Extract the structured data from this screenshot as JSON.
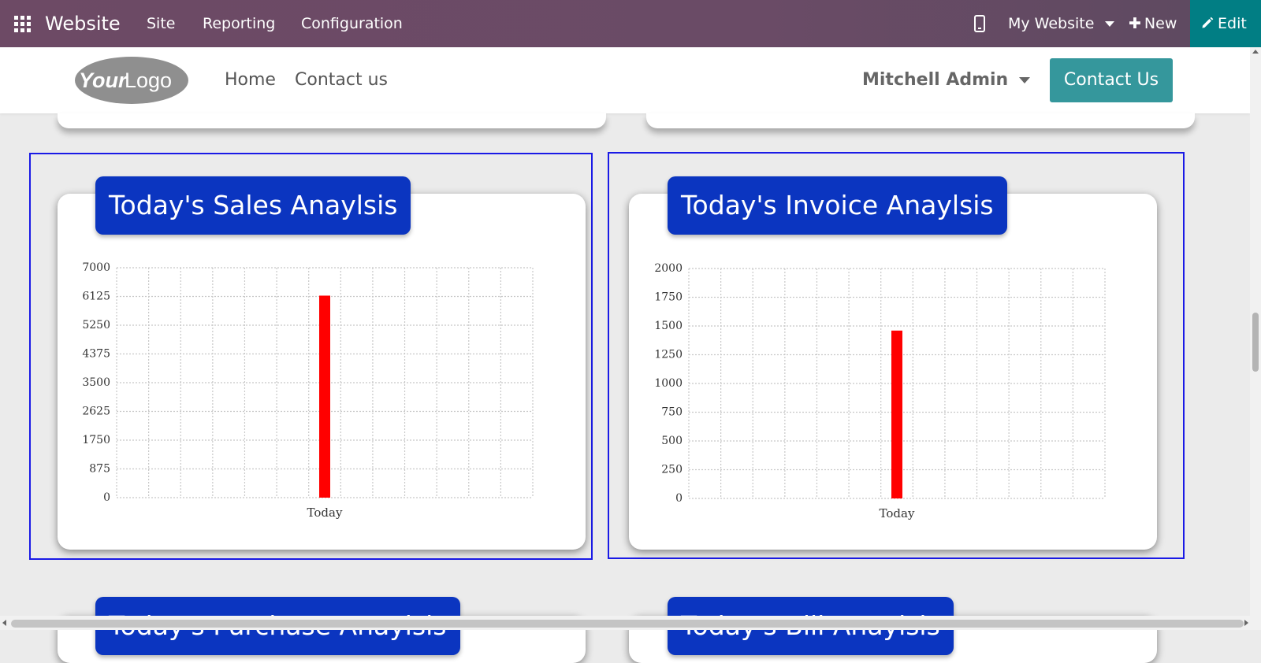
{
  "topbar": {
    "app_name": "Website",
    "menu": [
      "Site",
      "Reporting",
      "Configuration"
    ],
    "website_selector": "My Website",
    "new_label": "New",
    "edit_label": "Edit"
  },
  "header": {
    "logo_text_bold": "Your",
    "logo_text_light": "Logo",
    "nav": [
      "Home",
      "Contact us"
    ],
    "user": "Mitchell Admin",
    "contact_button": "Contact Us"
  },
  "cards": {
    "sales_title": "Today's Sales Anaylsis",
    "invoice_title": "Today's Invoice Anaylsis",
    "purchase_title": "Today's Purchase Anaylsis",
    "bill_title": "Today's Bill Anaylsis"
  },
  "chart_data": [
    {
      "type": "bar",
      "categories": [
        "Today"
      ],
      "values": [
        6150
      ],
      "yticks": [
        0,
        875,
        1750,
        2625,
        3500,
        4375,
        5250,
        6125,
        7000
      ],
      "ylim": [
        0,
        7000
      ],
      "grid": true,
      "color": "#ff0000"
    },
    {
      "type": "bar",
      "categories": [
        "Today"
      ],
      "values": [
        1460
      ],
      "yticks": [
        0,
        250,
        500,
        750,
        1000,
        1250,
        1500,
        1750,
        2000
      ],
      "ylim": [
        0,
        2000
      ],
      "grid": true,
      "color": "#ff0000"
    }
  ],
  "colors": {
    "topbar": "#6d4a65",
    "edit_button": "#017e84",
    "contact_button": "#35979c",
    "title_tab": "#0b35c0",
    "frame_border": "#1a1ae6",
    "bar": "#ff0000"
  }
}
